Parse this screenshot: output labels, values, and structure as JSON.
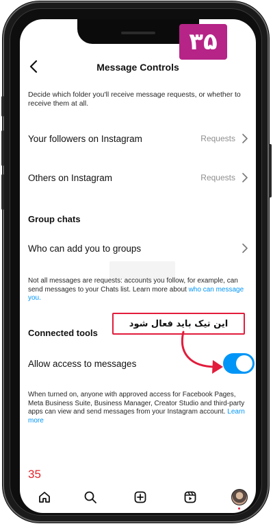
{
  "header": {
    "title": "Message Controls",
    "badge": "۳۵"
  },
  "intro": "Decide which folder you'll receive message requests, or whether to receive them at all.",
  "rows": [
    {
      "label": "Your followers on Instagram",
      "value": "Requests"
    },
    {
      "label": "Others on Instagram",
      "value": "Requests"
    }
  ],
  "group_chats": {
    "title": "Group chats",
    "row_label": "Who can add you to groups"
  },
  "requests_note": {
    "text": "Not all messages are requests: accounts you follow, for example, can send messages to your Chats list. Learn more about ",
    "link": "who can message you."
  },
  "connected_tools": {
    "title": "Connected tools",
    "toggle_label": "Allow access to messages",
    "toggle_on": true,
    "note": "When turned on, anyone with approved access for Facebook Pages, Meta Business Suite, Business Manager, Creator Studio and third-party apps can view and send messages from your Instagram account. ",
    "note_link": "Learn more"
  },
  "annotation": "این تیک باید فعال شود",
  "page_number": "35",
  "tabbar": [
    "home-icon",
    "search-icon",
    "create-icon",
    "reels-icon",
    "profile-avatar"
  ],
  "colors": {
    "accent": "#0095f6",
    "badge": "#b62487",
    "annotation": "#e21c3c"
  }
}
